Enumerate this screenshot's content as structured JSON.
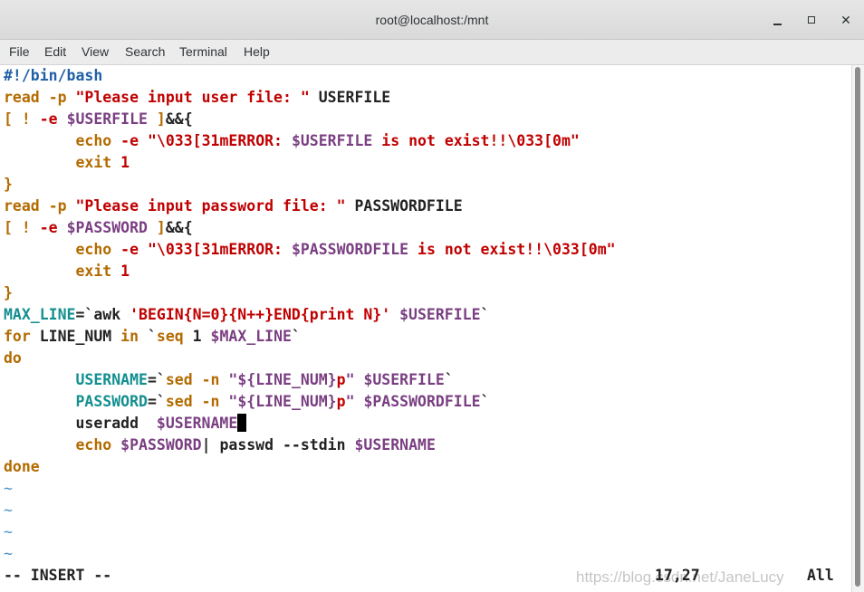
{
  "window": {
    "title": "root@localhost:/mnt"
  },
  "menu": [
    "File",
    "Edit",
    "View",
    "Search",
    "Terminal",
    "Help"
  ],
  "editor": {
    "lines": [
      [
        [
          "#!/bin/bash",
          "c-sha"
        ]
      ],
      [
        [
          "read",
          "c-kw"
        ],
        [
          " ",
          ""
        ],
        [
          "-p",
          "c-kw"
        ],
        [
          " ",
          ""
        ],
        [
          "\"Please input user file: \"",
          "c-str"
        ],
        [
          " USERFILE",
          ""
        ]
      ],
      [
        [
          "[ ! ",
          "c-kw"
        ],
        [
          "-e",
          "c-str"
        ],
        [
          " ",
          ""
        ],
        [
          "$USERFILE",
          "c-var"
        ],
        [
          " ]",
          "c-kw"
        ],
        [
          "&&{",
          ""
        ]
      ],
      [
        [
          "        ",
          ""
        ],
        [
          "echo",
          "c-kw"
        ],
        [
          " ",
          ""
        ],
        [
          "-e",
          "c-str"
        ],
        [
          " ",
          ""
        ],
        [
          "\"\\033[31mERROR: ",
          "c-str"
        ],
        [
          "$USERFILE",
          "c-var"
        ],
        [
          " is not exist!!\\033[0m\"",
          "c-str"
        ]
      ],
      [
        [
          "        ",
          ""
        ],
        [
          "exit",
          "c-kw"
        ],
        [
          " 1",
          "c-str"
        ]
      ],
      [
        [
          "}",
          "c-kw"
        ]
      ],
      [
        [
          "read",
          "c-kw"
        ],
        [
          " ",
          ""
        ],
        [
          "-p",
          "c-kw"
        ],
        [
          " ",
          ""
        ],
        [
          "\"Please input password file: \"",
          "c-str"
        ],
        [
          " PASSWORDFILE",
          ""
        ]
      ],
      [
        [
          "[ ! ",
          "c-kw"
        ],
        [
          "-e",
          "c-str"
        ],
        [
          " ",
          ""
        ],
        [
          "$PASSWORD",
          "c-var"
        ],
        [
          " ]",
          "c-kw"
        ],
        [
          "&&{",
          ""
        ]
      ],
      [
        [
          "        ",
          ""
        ],
        [
          "echo",
          "c-kw"
        ],
        [
          " ",
          ""
        ],
        [
          "-e",
          "c-str"
        ],
        [
          " ",
          ""
        ],
        [
          "\"\\033[31mERROR: ",
          "c-str"
        ],
        [
          "$PASSWORDFILE",
          "c-var"
        ],
        [
          " is not exist!!\\033[0m\"",
          "c-str"
        ]
      ],
      [
        [
          "        ",
          ""
        ],
        [
          "exit",
          "c-kw"
        ],
        [
          " 1",
          "c-str"
        ]
      ],
      [
        [
          "}",
          "c-kw"
        ]
      ],
      [
        [
          "MAX_LINE",
          "c-cyan"
        ],
        [
          "=`awk ",
          ""
        ],
        [
          "'BEGIN{N=0}{N++}END{print N}'",
          "c-str"
        ],
        [
          " ",
          ""
        ],
        [
          "$USERFILE",
          "c-var"
        ],
        [
          "`",
          ""
        ]
      ],
      [
        [
          "for",
          "c-kw"
        ],
        [
          " LINE_NUM ",
          ""
        ],
        [
          "in",
          "c-kw"
        ],
        [
          " `",
          ""
        ],
        [
          "seq",
          "c-kw"
        ],
        [
          " 1 ",
          ""
        ],
        [
          "$MAX_LINE",
          "c-var"
        ],
        [
          "`",
          ""
        ]
      ],
      [
        [
          "do",
          "c-kw"
        ]
      ],
      [
        [
          "        ",
          ""
        ],
        [
          "USERNAME",
          "c-cyan"
        ],
        [
          "=`",
          ""
        ],
        [
          "sed",
          "c-kw"
        ],
        [
          " ",
          ""
        ],
        [
          "-n",
          "c-kw"
        ],
        [
          " \"",
          "c-var"
        ],
        [
          "${LINE_NUM}",
          "c-var"
        ],
        [
          "p",
          "c-str"
        ],
        [
          "\"",
          "c-var"
        ],
        [
          " ",
          ""
        ],
        [
          "$USERFILE",
          "c-var"
        ],
        [
          "`",
          ""
        ]
      ],
      [
        [
          "        ",
          ""
        ],
        [
          "PASSWORD",
          "c-cyan"
        ],
        [
          "=`",
          ""
        ],
        [
          "sed",
          "c-kw"
        ],
        [
          " ",
          ""
        ],
        [
          "-n",
          "c-kw"
        ],
        [
          " \"",
          "c-var"
        ],
        [
          "${LINE_NUM}",
          "c-var"
        ],
        [
          "p",
          "c-str"
        ],
        [
          "\"",
          "c-var"
        ],
        [
          " ",
          ""
        ],
        [
          "$PASSWORDFILE",
          "c-var"
        ],
        [
          "`",
          ""
        ]
      ],
      [
        [
          "        useradd  ",
          ""
        ],
        [
          "$USERNAME",
          "c-var"
        ],
        [
          "\u0000CURSOR",
          ""
        ]
      ],
      [
        [
          "        ",
          ""
        ],
        [
          "echo",
          "c-kw"
        ],
        [
          " ",
          ""
        ],
        [
          "$PASSWORD",
          "c-var"
        ],
        [
          "| passwd --stdin ",
          ""
        ],
        [
          "$USERNAME",
          "c-var"
        ]
      ],
      [
        [
          "done",
          "c-kw"
        ]
      ],
      [
        [
          "~",
          "c-tilde"
        ]
      ],
      [
        [
          "~",
          "c-tilde"
        ]
      ],
      [
        [
          "~",
          "c-tilde"
        ]
      ],
      [
        [
          "~",
          "c-tilde"
        ]
      ]
    ],
    "mode": "-- INSERT --",
    "position": "17,27",
    "scroll": "All"
  },
  "watermark": "https://blog.csdn.net/JaneLucy"
}
